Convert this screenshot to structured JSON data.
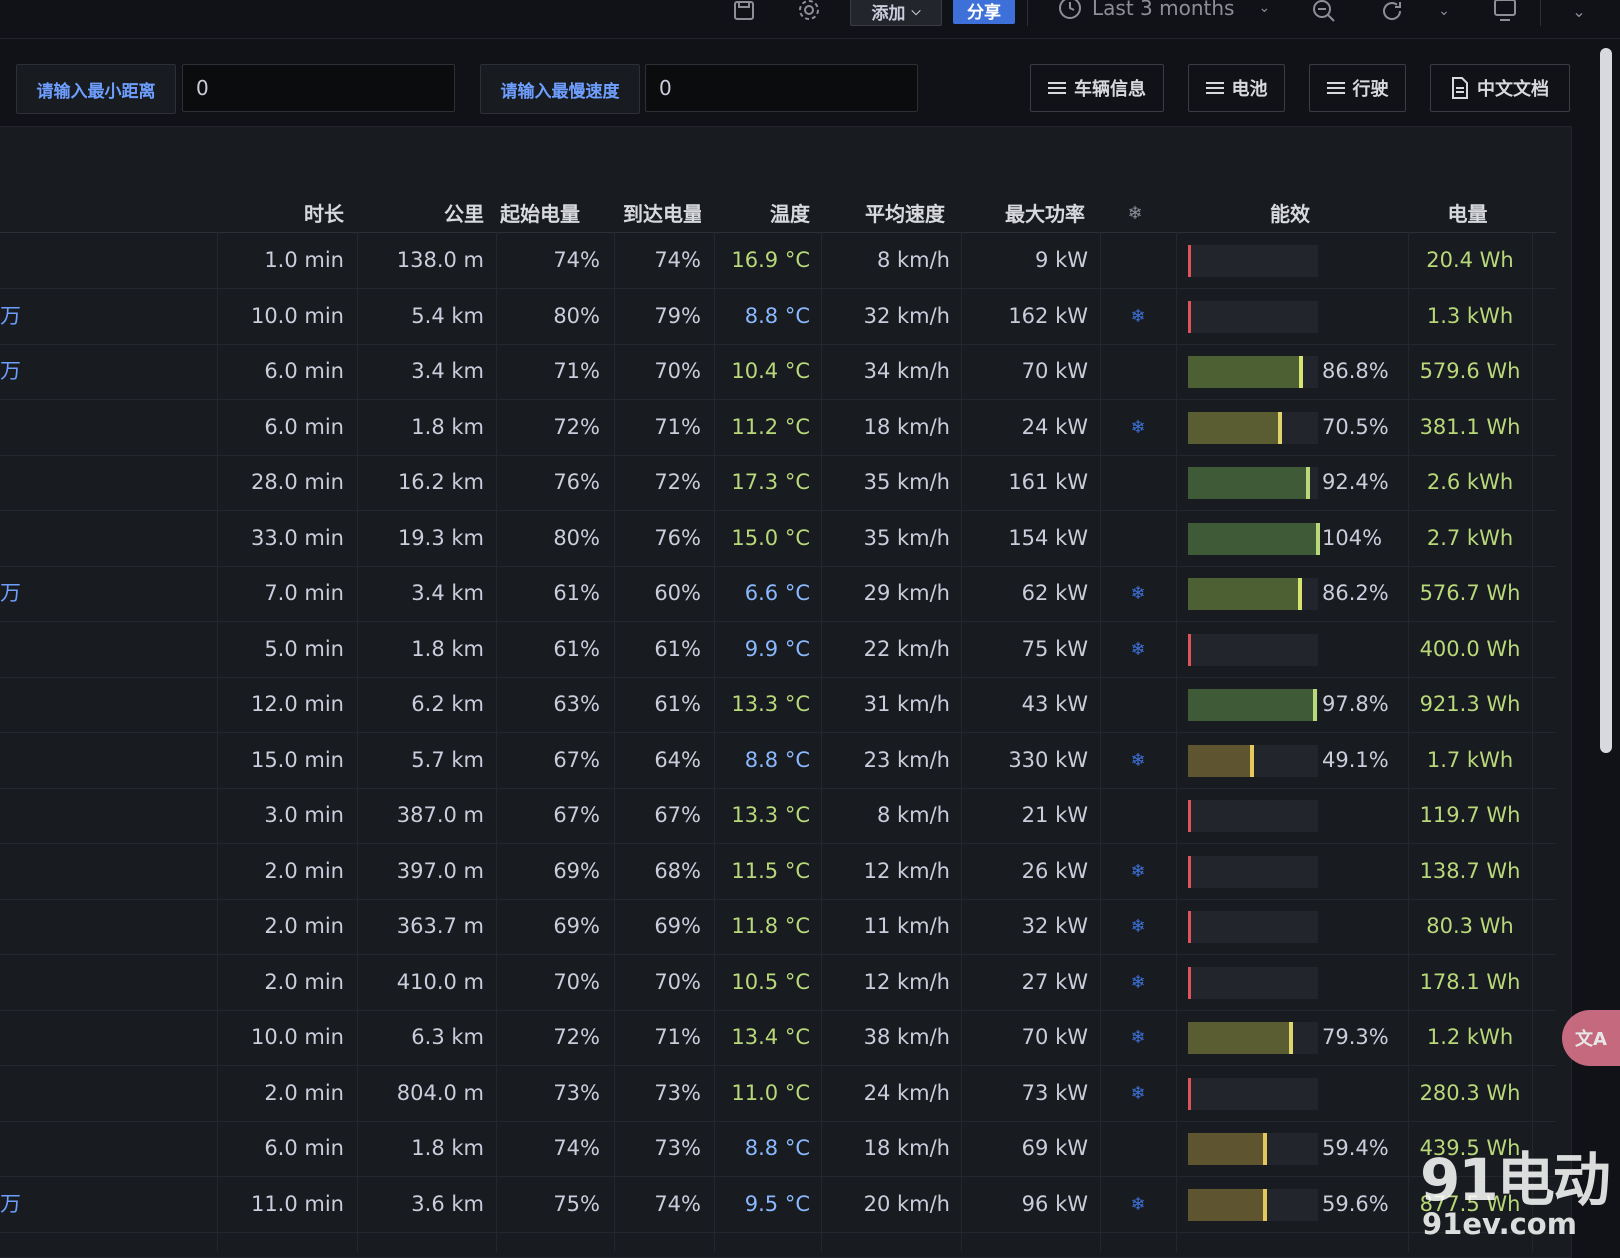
{
  "toolbar": {
    "add_label": "添加",
    "share_label": "分享",
    "time_range": "Last 3 months"
  },
  "filters": {
    "min_distance_label": "请输入最小距离",
    "min_distance_value": "0",
    "min_speed_label": "请输入最慢速度",
    "min_speed_value": "0"
  },
  "links": {
    "vehicle_info": "车辆信息",
    "battery": "电池",
    "driving": "行驶",
    "chinese_docs": "中文文档"
  },
  "table": {
    "headers": {
      "duration": "时长",
      "distance": "公里",
      "start_soc": "起始电量",
      "end_soc": "到达电量",
      "temperature": "温度",
      "avg_speed": "平均速度",
      "max_power": "最大功率",
      "ac": "❄",
      "efficiency": "能效",
      "energy": "电量"
    },
    "rows": [
      {
        "link": "",
        "duration": "1.0 min",
        "distance": "138.0 m",
        "start": "74%",
        "end": "74%",
        "temp": "16.9 °C",
        "cool": false,
        "speed": "8 km/h",
        "power": "9 kW",
        "ac": false,
        "eff": 0,
        "eff_label": "",
        "energy": "20.4 Wh"
      },
      {
        "link": "万",
        "duration": "10.0 min",
        "distance": "5.4 km",
        "start": "80%",
        "end": "79%",
        "temp": "8.8 °C",
        "cool": true,
        "speed": "32 km/h",
        "power": "162 kW",
        "ac": true,
        "eff": 0,
        "eff_label": "",
        "energy": "1.3 kWh"
      },
      {
        "link": "万",
        "duration": "6.0 min",
        "distance": "3.4 km",
        "start": "71%",
        "end": "70%",
        "temp": "10.4 °C",
        "cool": false,
        "speed": "34 km/h",
        "power": "70 kW",
        "ac": false,
        "eff": 86.8,
        "eff_label": "86.8%",
        "energy": "579.6 Wh"
      },
      {
        "link": "",
        "duration": "6.0 min",
        "distance": "1.8 km",
        "start": "72%",
        "end": "71%",
        "temp": "11.2 °C",
        "cool": false,
        "speed": "18 km/h",
        "power": "24 kW",
        "ac": true,
        "eff": 70.5,
        "eff_label": "70.5%",
        "energy": "381.1 Wh"
      },
      {
        "link": "",
        "duration": "28.0 min",
        "distance": "16.2 km",
        "start": "76%",
        "end": "72%",
        "temp": "17.3 °C",
        "cool": false,
        "speed": "35 km/h",
        "power": "161 kW",
        "ac": false,
        "eff": 92.4,
        "eff_label": "92.4%",
        "energy": "2.6 kWh"
      },
      {
        "link": "",
        "duration": "33.0 min",
        "distance": "19.3 km",
        "start": "80%",
        "end": "76%",
        "temp": "15.0 °C",
        "cool": false,
        "speed": "35 km/h",
        "power": "154 kW",
        "ac": false,
        "eff": 104,
        "eff_label": "104%",
        "energy": "2.7 kWh"
      },
      {
        "link": "万",
        "duration": "7.0 min",
        "distance": "3.4 km",
        "start": "61%",
        "end": "60%",
        "temp": "6.6 °C",
        "cool": true,
        "speed": "29 km/h",
        "power": "62 kW",
        "ac": true,
        "eff": 86.2,
        "eff_label": "86.2%",
        "energy": "576.7 Wh"
      },
      {
        "link": "",
        "duration": "5.0 min",
        "distance": "1.8 km",
        "start": "61%",
        "end": "61%",
        "temp": "9.9 °C",
        "cool": true,
        "speed": "22 km/h",
        "power": "75 kW",
        "ac": true,
        "eff": 0,
        "eff_label": "",
        "energy": "400.0 Wh"
      },
      {
        "link": "",
        "duration": "12.0 min",
        "distance": "6.2 km",
        "start": "63%",
        "end": "61%",
        "temp": "13.3 °C",
        "cool": false,
        "speed": "31 km/h",
        "power": "43 kW",
        "ac": false,
        "eff": 97.8,
        "eff_label": "97.8%",
        "energy": "921.3 Wh"
      },
      {
        "link": "",
        "duration": "15.0 min",
        "distance": "5.7 km",
        "start": "67%",
        "end": "64%",
        "temp": "8.8 °C",
        "cool": true,
        "speed": "23 km/h",
        "power": "330 kW",
        "ac": true,
        "eff": 49.1,
        "eff_label": "49.1%",
        "energy": "1.7 kWh"
      },
      {
        "link": "",
        "duration": "3.0 min",
        "distance": "387.0 m",
        "start": "67%",
        "end": "67%",
        "temp": "13.3 °C",
        "cool": false,
        "speed": "8 km/h",
        "power": "21 kW",
        "ac": false,
        "eff": 0,
        "eff_label": "",
        "energy": "119.7 Wh"
      },
      {
        "link": "",
        "duration": "2.0 min",
        "distance": "397.0 m",
        "start": "69%",
        "end": "68%",
        "temp": "11.5 °C",
        "cool": false,
        "speed": "12 km/h",
        "power": "26 kW",
        "ac": true,
        "eff": 0,
        "eff_label": "",
        "energy": "138.7 Wh"
      },
      {
        "link": "",
        "duration": "2.0 min",
        "distance": "363.7 m",
        "start": "69%",
        "end": "69%",
        "temp": "11.8 °C",
        "cool": false,
        "speed": "11 km/h",
        "power": "32 kW",
        "ac": true,
        "eff": 0,
        "eff_label": "",
        "energy": "80.3 Wh"
      },
      {
        "link": "",
        "duration": "2.0 min",
        "distance": "410.0 m",
        "start": "70%",
        "end": "70%",
        "temp": "10.5 °C",
        "cool": false,
        "speed": "12 km/h",
        "power": "27 kW",
        "ac": true,
        "eff": 0,
        "eff_label": "",
        "energy": "178.1 Wh"
      },
      {
        "link": "",
        "duration": "10.0 min",
        "distance": "6.3 km",
        "start": "72%",
        "end": "71%",
        "temp": "13.4 °C",
        "cool": false,
        "speed": "38 km/h",
        "power": "70 kW",
        "ac": true,
        "eff": 79.3,
        "eff_label": "79.3%",
        "energy": "1.2 kWh"
      },
      {
        "link": "",
        "duration": "2.0 min",
        "distance": "804.0 m",
        "start": "73%",
        "end": "73%",
        "temp": "11.0 °C",
        "cool": false,
        "speed": "24 km/h",
        "power": "73 kW",
        "ac": true,
        "eff": 0,
        "eff_label": "",
        "energy": "280.3 Wh"
      },
      {
        "link": "",
        "duration": "6.0 min",
        "distance": "1.8 km",
        "start": "74%",
        "end": "73%",
        "temp": "8.8 °C",
        "cool": true,
        "speed": "18 km/h",
        "power": "69 kW",
        "ac": false,
        "eff": 59.4,
        "eff_label": "59.4%",
        "energy": "439.5 Wh"
      },
      {
        "link": "万",
        "duration": "11.0 min",
        "distance": "3.6 km",
        "start": "75%",
        "end": "74%",
        "temp": "9.5 °C",
        "cool": true,
        "speed": "20 km/h",
        "power": "96 kW",
        "ac": true,
        "eff": 59.6,
        "eff_label": "59.6%",
        "energy": "877.5 Wh"
      }
    ]
  },
  "floating": {
    "translate": "文A",
    "watermark_big": "91电动",
    "watermark_small": "91ev.com"
  }
}
